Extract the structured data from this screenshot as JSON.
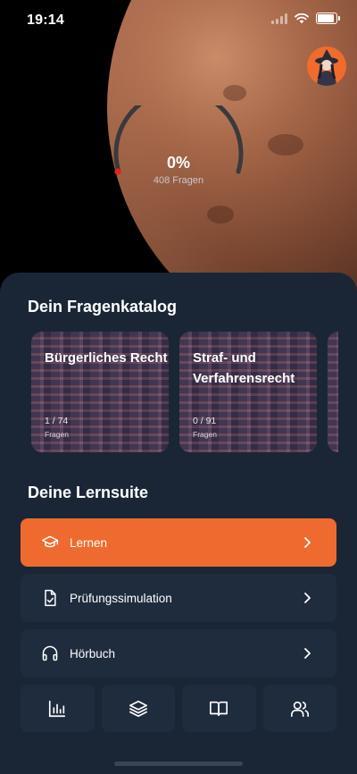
{
  "status_bar": {
    "time": "19:14"
  },
  "progress": {
    "percent_label": "0%",
    "questions_label": "408 Fragen",
    "fraction": 0
  },
  "catalog": {
    "title": "Dein Fragenkatalog",
    "cards": [
      {
        "title": "Bürgerliches Recht",
        "count": "1 / 74",
        "unit": "Fragen"
      },
      {
        "title": "Straf- und Verfahrensrecht",
        "count": "0 / 91",
        "unit": "Fragen"
      }
    ]
  },
  "suite": {
    "title": "Deine Lernsuite",
    "items": [
      {
        "label": "Lernen",
        "icon": "graduation-cap-icon",
        "active": true
      },
      {
        "label": "Prüfungssimulation",
        "icon": "file-check-icon",
        "active": false
      },
      {
        "label": "Hörbuch",
        "icon": "headphones-icon",
        "active": false
      }
    ]
  },
  "bottom_bar": {
    "icons": [
      "bar-chart-icon",
      "layers-icon",
      "book-open-icon",
      "users-icon"
    ]
  },
  "colors": {
    "accent": "#ef6a2e",
    "sheet_bg": "#1a2636",
    "item_bg": "#1f2c3e",
    "gauge_dot": "#e0241f"
  }
}
